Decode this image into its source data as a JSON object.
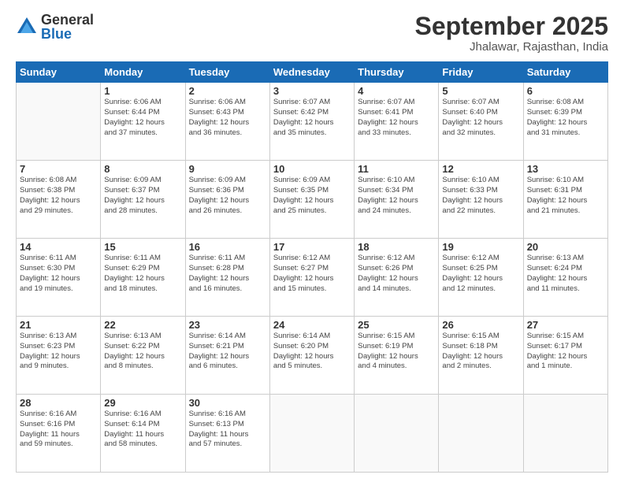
{
  "logo": {
    "general": "General",
    "blue": "Blue"
  },
  "header": {
    "month": "September 2025",
    "location": "Jhalawar, Rajasthan, India"
  },
  "days_of_week": [
    "Sunday",
    "Monday",
    "Tuesday",
    "Wednesday",
    "Thursday",
    "Friday",
    "Saturday"
  ],
  "weeks": [
    [
      {
        "day": "",
        "info": ""
      },
      {
        "day": "1",
        "info": "Sunrise: 6:06 AM\nSunset: 6:44 PM\nDaylight: 12 hours\nand 37 minutes."
      },
      {
        "day": "2",
        "info": "Sunrise: 6:06 AM\nSunset: 6:43 PM\nDaylight: 12 hours\nand 36 minutes."
      },
      {
        "day": "3",
        "info": "Sunrise: 6:07 AM\nSunset: 6:42 PM\nDaylight: 12 hours\nand 35 minutes."
      },
      {
        "day": "4",
        "info": "Sunrise: 6:07 AM\nSunset: 6:41 PM\nDaylight: 12 hours\nand 33 minutes."
      },
      {
        "day": "5",
        "info": "Sunrise: 6:07 AM\nSunset: 6:40 PM\nDaylight: 12 hours\nand 32 minutes."
      },
      {
        "day": "6",
        "info": "Sunrise: 6:08 AM\nSunset: 6:39 PM\nDaylight: 12 hours\nand 31 minutes."
      }
    ],
    [
      {
        "day": "7",
        "info": "Sunrise: 6:08 AM\nSunset: 6:38 PM\nDaylight: 12 hours\nand 29 minutes."
      },
      {
        "day": "8",
        "info": "Sunrise: 6:09 AM\nSunset: 6:37 PM\nDaylight: 12 hours\nand 28 minutes."
      },
      {
        "day": "9",
        "info": "Sunrise: 6:09 AM\nSunset: 6:36 PM\nDaylight: 12 hours\nand 26 minutes."
      },
      {
        "day": "10",
        "info": "Sunrise: 6:09 AM\nSunset: 6:35 PM\nDaylight: 12 hours\nand 25 minutes."
      },
      {
        "day": "11",
        "info": "Sunrise: 6:10 AM\nSunset: 6:34 PM\nDaylight: 12 hours\nand 24 minutes."
      },
      {
        "day": "12",
        "info": "Sunrise: 6:10 AM\nSunset: 6:33 PM\nDaylight: 12 hours\nand 22 minutes."
      },
      {
        "day": "13",
        "info": "Sunrise: 6:10 AM\nSunset: 6:31 PM\nDaylight: 12 hours\nand 21 minutes."
      }
    ],
    [
      {
        "day": "14",
        "info": "Sunrise: 6:11 AM\nSunset: 6:30 PM\nDaylight: 12 hours\nand 19 minutes."
      },
      {
        "day": "15",
        "info": "Sunrise: 6:11 AM\nSunset: 6:29 PM\nDaylight: 12 hours\nand 18 minutes."
      },
      {
        "day": "16",
        "info": "Sunrise: 6:11 AM\nSunset: 6:28 PM\nDaylight: 12 hours\nand 16 minutes."
      },
      {
        "day": "17",
        "info": "Sunrise: 6:12 AM\nSunset: 6:27 PM\nDaylight: 12 hours\nand 15 minutes."
      },
      {
        "day": "18",
        "info": "Sunrise: 6:12 AM\nSunset: 6:26 PM\nDaylight: 12 hours\nand 14 minutes."
      },
      {
        "day": "19",
        "info": "Sunrise: 6:12 AM\nSunset: 6:25 PM\nDaylight: 12 hours\nand 12 minutes."
      },
      {
        "day": "20",
        "info": "Sunrise: 6:13 AM\nSunset: 6:24 PM\nDaylight: 12 hours\nand 11 minutes."
      }
    ],
    [
      {
        "day": "21",
        "info": "Sunrise: 6:13 AM\nSunset: 6:23 PM\nDaylight: 12 hours\nand 9 minutes."
      },
      {
        "day": "22",
        "info": "Sunrise: 6:13 AM\nSunset: 6:22 PM\nDaylight: 12 hours\nand 8 minutes."
      },
      {
        "day": "23",
        "info": "Sunrise: 6:14 AM\nSunset: 6:21 PM\nDaylight: 12 hours\nand 6 minutes."
      },
      {
        "day": "24",
        "info": "Sunrise: 6:14 AM\nSunset: 6:20 PM\nDaylight: 12 hours\nand 5 minutes."
      },
      {
        "day": "25",
        "info": "Sunrise: 6:15 AM\nSunset: 6:19 PM\nDaylight: 12 hours\nand 4 minutes."
      },
      {
        "day": "26",
        "info": "Sunrise: 6:15 AM\nSunset: 6:18 PM\nDaylight: 12 hours\nand 2 minutes."
      },
      {
        "day": "27",
        "info": "Sunrise: 6:15 AM\nSunset: 6:17 PM\nDaylight: 12 hours\nand 1 minute."
      }
    ],
    [
      {
        "day": "28",
        "info": "Sunrise: 6:16 AM\nSunset: 6:16 PM\nDaylight: 11 hours\nand 59 minutes."
      },
      {
        "day": "29",
        "info": "Sunrise: 6:16 AM\nSunset: 6:14 PM\nDaylight: 11 hours\nand 58 minutes."
      },
      {
        "day": "30",
        "info": "Sunrise: 6:16 AM\nSunset: 6:13 PM\nDaylight: 11 hours\nand 57 minutes."
      },
      {
        "day": "",
        "info": ""
      },
      {
        "day": "",
        "info": ""
      },
      {
        "day": "",
        "info": ""
      },
      {
        "day": "",
        "info": ""
      }
    ]
  ]
}
